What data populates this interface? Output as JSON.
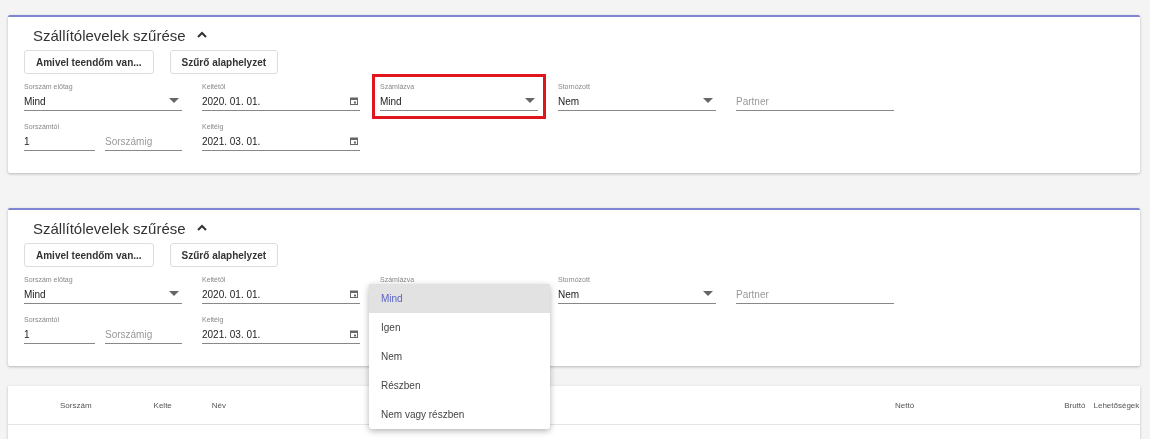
{
  "panels": [
    {
      "title": "Szállítólevelek szűrése",
      "expanded": true,
      "buttons": [
        "Amivel teendőm van...",
        "Szűrő alaphelyzet"
      ],
      "rows": [
        [
          {
            "kind": "select",
            "label": "Sorszám előtag",
            "value": "Mind"
          },
          {
            "kind": "date",
            "label": "Keltétől",
            "value": "2020. 01. 01."
          },
          {
            "kind": "select",
            "label": "Számlázva",
            "value": "Mind",
            "highlight": true
          },
          {
            "kind": "select",
            "label": "Stornózott",
            "value": "Nem"
          },
          {
            "kind": "text",
            "placeholder": "Partner"
          }
        ],
        [
          {
            "kind": "pair",
            "items": [
              {
                "kind": "text",
                "label": "Sorszámtól",
                "value": "1"
              },
              {
                "kind": "text",
                "placeholder": "Sorszámig"
              }
            ]
          },
          {
            "kind": "date",
            "label": "Keltéig",
            "value": "2021. 03. 01."
          }
        ]
      ]
    },
    {
      "title": "Szállítólevelek szűrése",
      "expanded": true,
      "buttons": [
        "Amivel teendőm van...",
        "Szűrő alaphelyzet"
      ],
      "rows": [
        [
          {
            "kind": "select",
            "label": "Sorszám előtag",
            "value": "Mind"
          },
          {
            "kind": "date",
            "label": "Keltétől",
            "value": "2020. 01. 01."
          },
          {
            "kind": "menu",
            "label": "Számlázva",
            "options": [
              {
                "label": "Mind",
                "selected": true
              },
              {
                "label": "Igen",
                "selected": false
              },
              {
                "label": "Nem",
                "selected": false
              },
              {
                "label": "Részben",
                "selected": false
              },
              {
                "label": "Nem vagy részben",
                "selected": false
              }
            ]
          },
          {
            "kind": "select",
            "label": "Stornózott",
            "value": "Nem"
          },
          {
            "kind": "text",
            "placeholder": "Partner"
          }
        ],
        [
          {
            "kind": "pair",
            "items": [
              {
                "kind": "text",
                "label": "Sorszámtól",
                "value": "1"
              },
              {
                "kind": "text",
                "placeholder": "Sorszámig"
              }
            ]
          },
          {
            "kind": "date",
            "label": "Keltéig",
            "value": "2021. 03. 01."
          }
        ]
      ]
    }
  ],
  "table": {
    "columns": [
      "Sorszám",
      "Kelte",
      "Név",
      "Nettó",
      "Bruttó",
      "Lehetőségek"
    ]
  }
}
